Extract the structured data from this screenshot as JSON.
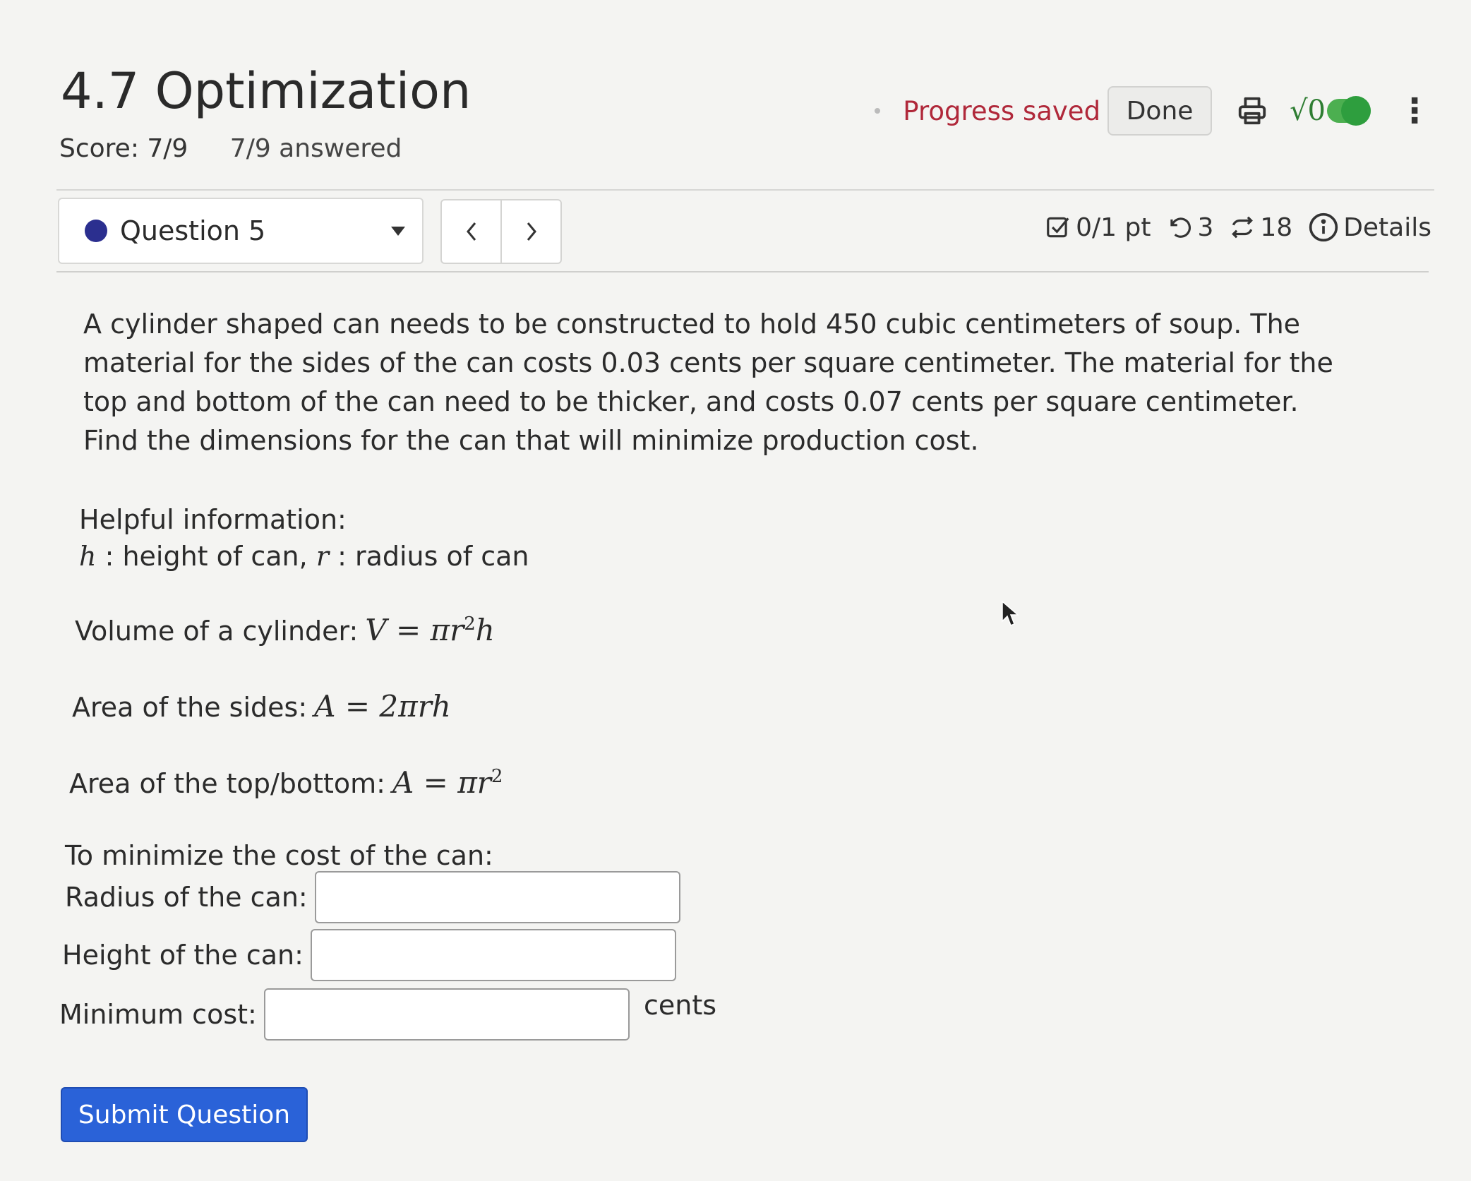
{
  "header": {
    "title": "4.7 Optimization",
    "score": "Score: 7/9",
    "answered": "7/9 answered",
    "progress_text": "Progress saved",
    "done_label": "Done",
    "math_toggle_label": "√0"
  },
  "question_nav": {
    "selected_question": "Question 5",
    "meta": {
      "points": "0/1 pt",
      "retries": "3",
      "attempts": "18",
      "details_label": "Details"
    }
  },
  "problem": {
    "text": "A cylinder shaped can needs to be constructed to hold 450 cubic centimeters of soup. The material for the sides of the can costs 0.03 cents per square centimeter. The material for the top and bottom of the can need to be thicker, and costs 0.07 cents per square centimeter. Find the dimensions for the can that will minimize production cost.",
    "helpful_title": "Helpful information:",
    "var_h": "h",
    "var_h_desc": ": height of can,",
    "var_r": "r",
    "var_r_desc": ": radius of can",
    "volume_label": "Volume of a cylinder:",
    "volume_formula_base": "V = πr",
    "volume_formula_exp": "2",
    "volume_formula_tail": "h",
    "sides_label": "Area of the sides:",
    "sides_formula": "A = 2πrh",
    "topbottom_label": "Area of the top/bottom:",
    "topbottom_formula_base": "A = πr",
    "topbottom_formula_exp": "2"
  },
  "answer": {
    "minimize_label": "To minimize the cost of the can:",
    "radius_label": "Radius of the can:",
    "radius_value": "",
    "height_label": "Height of the can:",
    "height_value": "",
    "cost_label": "Minimum cost:",
    "cost_value": "",
    "cost_unit": "cents"
  },
  "submit_label": "Submit Question",
  "colors": {
    "progress": "#b0283a",
    "accent": "#2a62d8",
    "toggle": "#4caf50",
    "question_dot": "#2b2f8f"
  }
}
